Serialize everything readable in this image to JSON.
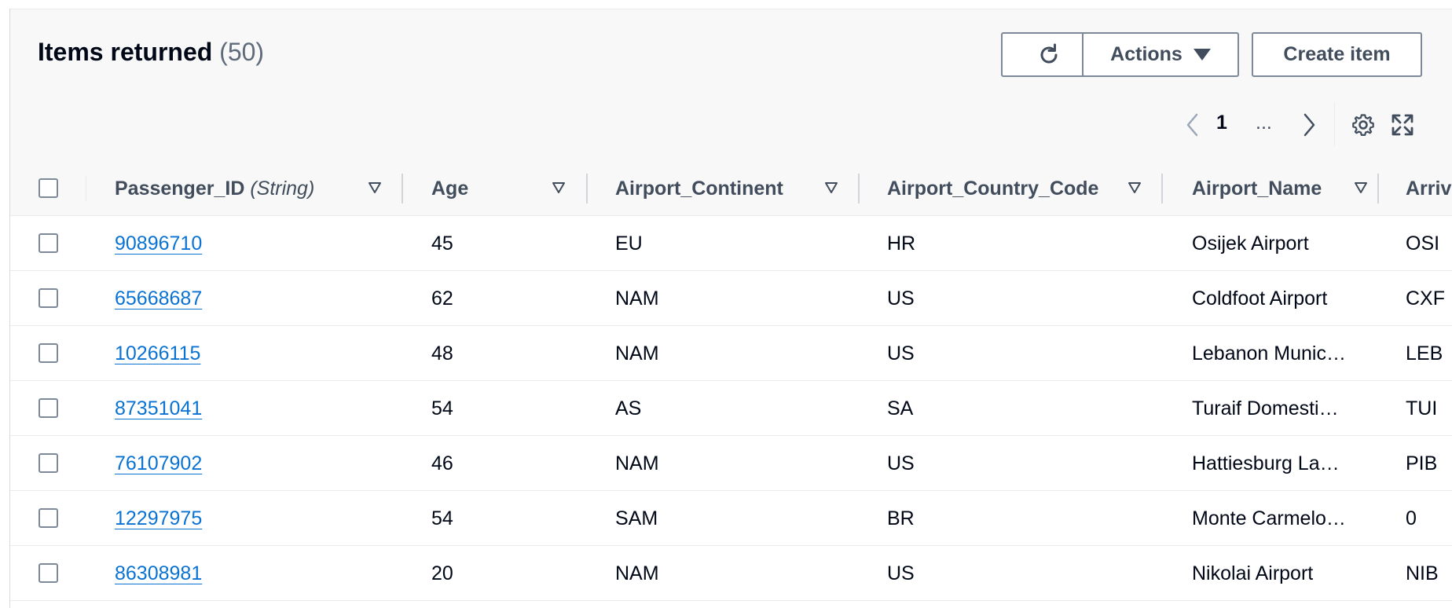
{
  "header": {
    "title": "Items returned",
    "count": "(50)"
  },
  "toolbar": {
    "refresh_icon": "refresh-icon",
    "actions_label": "Actions",
    "create_label": "Create item"
  },
  "pagination": {
    "current_page": "1",
    "ellipsis": "..."
  },
  "columns": [
    {
      "label": "Passenger_ID",
      "type": "(String)"
    },
    {
      "label": "Age",
      "type": ""
    },
    {
      "label": "Airport_Continent",
      "type": ""
    },
    {
      "label": "Airport_Country_Code",
      "type": ""
    },
    {
      "label": "Airport_Name",
      "type": ""
    },
    {
      "label": "Arriv",
      "type": ""
    }
  ],
  "rows": [
    {
      "id": "90896710",
      "age": "45",
      "continent": "EU",
      "country": "HR",
      "airport": "Osijek Airport",
      "arrival": "OSI"
    },
    {
      "id": "65668687",
      "age": "62",
      "continent": "NAM",
      "country": "US",
      "airport": "Coldfoot Airport",
      "arrival": "CXF"
    },
    {
      "id": "10266115",
      "age": "48",
      "continent": "NAM",
      "country": "US",
      "airport": "Lebanon Munic…",
      "arrival": "LEB"
    },
    {
      "id": "87351041",
      "age": "54",
      "continent": "AS",
      "country": "SA",
      "airport": "Turaif Domesti…",
      "arrival": "TUI"
    },
    {
      "id": "76107902",
      "age": "46",
      "continent": "NAM",
      "country": "US",
      "airport": "Hattiesburg La…",
      "arrival": "PIB"
    },
    {
      "id": "12297975",
      "age": "54",
      "continent": "SAM",
      "country": "BR",
      "airport": "Monte Carmelo…",
      "arrival": "0"
    },
    {
      "id": "86308981",
      "age": "20",
      "continent": "NAM",
      "country": "US",
      "airport": "Nikolai Airport",
      "arrival": "NIB"
    }
  ],
  "colors": {
    "link": "#0972d3",
    "text": "#000716",
    "muted": "#5f6b7a",
    "border": "#7d8998"
  }
}
